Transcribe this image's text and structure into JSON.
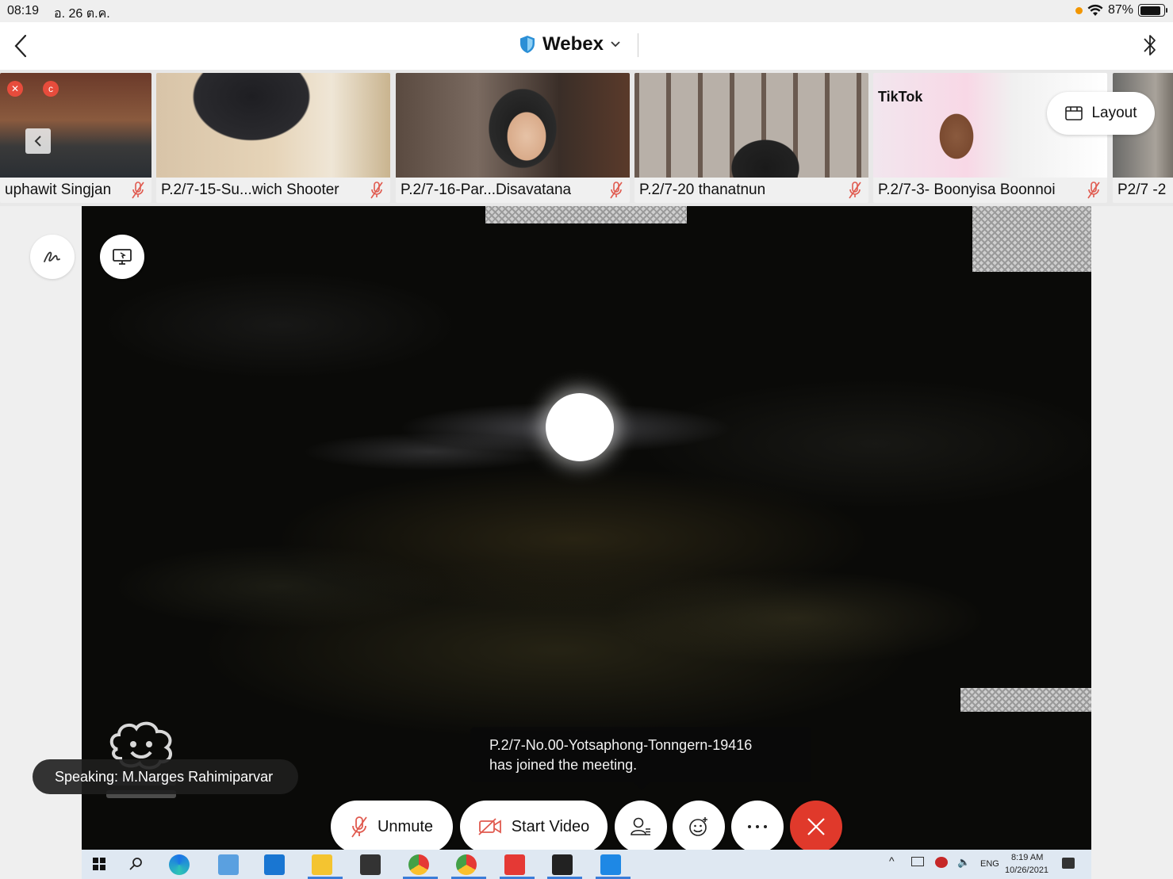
{
  "status_bar": {
    "time": "08:19",
    "date": "อ. 26 ต.ค.",
    "battery": "87%",
    "battery_level": 0.87
  },
  "header": {
    "title": "Webex",
    "back_icon": "chevron-left-icon",
    "dropdown_icon": "chevron-down-icon",
    "bluetooth_icon": "bluetooth-icon"
  },
  "participants": [
    {
      "name": "uphawit Singjan",
      "muted": true
    },
    {
      "name": "P.2/7-15-Su...wich Shooter",
      "muted": true
    },
    {
      "name": "P.2/7-16-Par...Disavatana",
      "muted": true
    },
    {
      "name": "P.2/7-20 thanatnun",
      "muted": true
    },
    {
      "name": "P.2/7-3- Boonyisa Boonnoi",
      "muted": true
    },
    {
      "name": "P2/7 -2",
      "muted": false
    }
  ],
  "thumb_tiktok_text": "TikTok",
  "layout_button": {
    "label": "Layout"
  },
  "speaking": {
    "text": "Speaking: M.Narges Rahimiparvar"
  },
  "toast": {
    "line1": "P.2/7-No.00-Yotsaphong-Tonngern-19416",
    "line2": "has joined the meeting."
  },
  "controls": {
    "unmute": "Unmute",
    "start_video": "Start Video"
  },
  "taskbar": {
    "language": "ENG",
    "clock_time": "8:19 AM",
    "clock_date": "10/26/2021"
  },
  "colors": {
    "end_call": "#e0392b",
    "muted_icon": "#e05a4f",
    "webex_shield": "#2b8fd6",
    "status_orange": "#f29600"
  }
}
